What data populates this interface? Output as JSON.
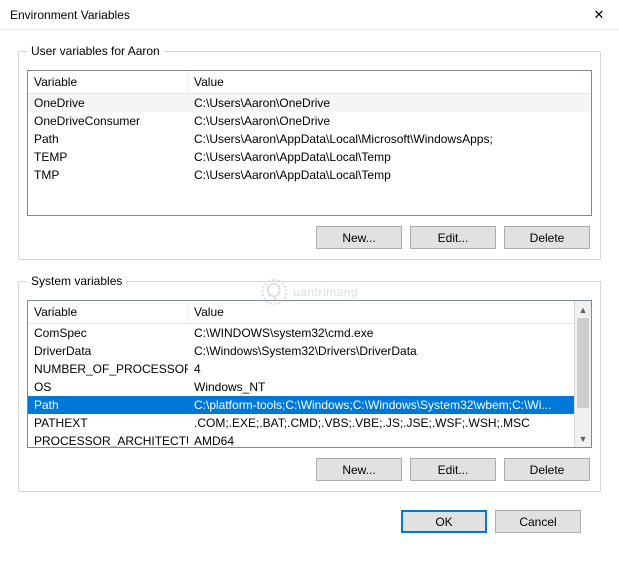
{
  "title": "Environment Variables",
  "close_glyph": "✕",
  "user_legend": "User variables for Aaron",
  "system_legend": "System variables",
  "col_variable": "Variable",
  "col_value": "Value",
  "user_vars": [
    {
      "name": "OneDrive",
      "value": "C:\\Users\\Aaron\\OneDrive"
    },
    {
      "name": "OneDriveConsumer",
      "value": "C:\\Users\\Aaron\\OneDrive"
    },
    {
      "name": "Path",
      "value": "C:\\Users\\Aaron\\AppData\\Local\\Microsoft\\WindowsApps;"
    },
    {
      "name": "TEMP",
      "value": "C:\\Users\\Aaron\\AppData\\Local\\Temp"
    },
    {
      "name": "TMP",
      "value": "C:\\Users\\Aaron\\AppData\\Local\\Temp"
    }
  ],
  "system_vars": [
    {
      "name": "ComSpec",
      "value": "C:\\WINDOWS\\system32\\cmd.exe"
    },
    {
      "name": "DriverData",
      "value": "C:\\Windows\\System32\\Drivers\\DriverData"
    },
    {
      "name": "NUMBER_OF_PROCESSORS",
      "value": "4"
    },
    {
      "name": "OS",
      "value": "Windows_NT"
    },
    {
      "name": "Path",
      "value": "C:\\platform-tools;C:\\Windows;C:\\Windows\\System32\\wbem;C:\\Wi...",
      "selected": true
    },
    {
      "name": "PATHEXT",
      "value": ".COM;.EXE;.BAT;.CMD;.VBS;.VBE;.JS;.JSE;.WSF;.WSH;.MSC"
    },
    {
      "name": "PROCESSOR_ARCHITECTURE",
      "value": "AMD64"
    }
  ],
  "btn_new": "New...",
  "btn_edit": "Edit...",
  "btn_delete": "Delete",
  "btn_ok": "OK",
  "btn_cancel": "Cancel",
  "scroll_up": "▲",
  "scroll_down": "▼",
  "watermark_brand": "uantrimang",
  "watermark_q": "Q"
}
